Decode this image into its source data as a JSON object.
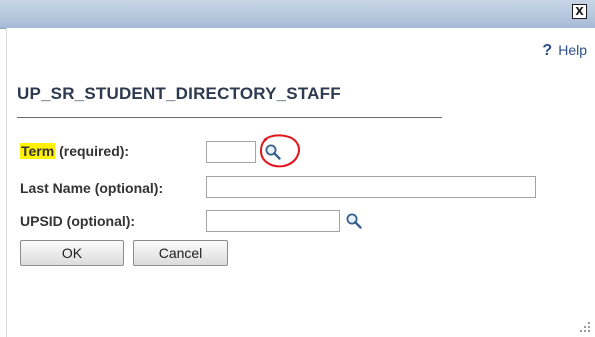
{
  "window": {
    "close_label": "X"
  },
  "help": {
    "icon": "?",
    "label": "Help"
  },
  "page": {
    "title": "UP_SR_STUDENT_DIRECTORY_STAFF"
  },
  "form": {
    "term": {
      "label_main": "Term",
      "label_suffix": " (required):",
      "value": ""
    },
    "last_name": {
      "label": "Last Name (optional):",
      "value": ""
    },
    "upsid": {
      "label": "UPSID (optional):",
      "value": ""
    }
  },
  "buttons": {
    "ok": "OK",
    "cancel": "Cancel"
  },
  "colors": {
    "highlight": "#fff200",
    "annotation": "#e3161b",
    "titlebar": "#b7c7de"
  }
}
